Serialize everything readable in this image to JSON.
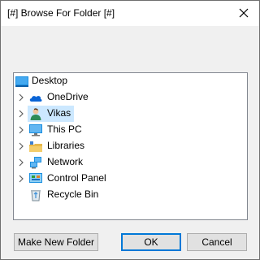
{
  "window": {
    "title": "[#] Browse For Folder [#]"
  },
  "icons": {
    "close": "close-icon",
    "expander": "chevron-right-icon"
  },
  "tree": {
    "root": {
      "label": "Desktop",
      "icon": "desktop-icon"
    },
    "items": [
      {
        "label": "OneDrive",
        "icon": "cloud-icon",
        "expandable": true,
        "selected": false
      },
      {
        "label": "Vikas",
        "icon": "user-icon",
        "expandable": true,
        "selected": true
      },
      {
        "label": "This PC",
        "icon": "computer-icon",
        "expandable": true,
        "selected": false
      },
      {
        "label": "Libraries",
        "icon": "libraries-icon",
        "expandable": true,
        "selected": false
      },
      {
        "label": "Network",
        "icon": "network-icon",
        "expandable": true,
        "selected": false
      },
      {
        "label": "Control Panel",
        "icon": "control-panel-icon",
        "expandable": true,
        "selected": false
      },
      {
        "label": "Recycle Bin",
        "icon": "recycle-bin-icon",
        "expandable": false,
        "selected": false
      }
    ]
  },
  "buttons": {
    "new_folder": "Make New Folder",
    "ok": "OK",
    "cancel": "Cancel"
  },
  "colors": {
    "selection": "#cce8ff",
    "accent": "#0078d7",
    "onedrive": "#0a64d6"
  }
}
